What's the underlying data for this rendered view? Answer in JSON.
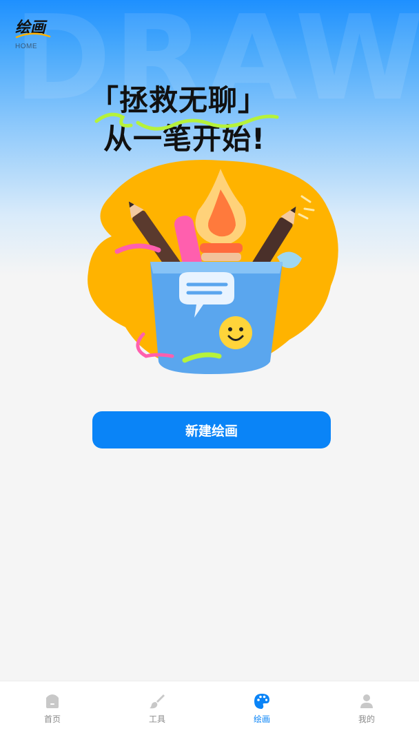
{
  "header": {
    "brand_title": "绘画",
    "brand_subtitle": "HOME",
    "watermark": "DRAWI"
  },
  "hero": {
    "slogan_line1": "「拯救无聊」",
    "slogan_line2": "从一笔开始!"
  },
  "main": {
    "new_drawing_label": "新建绘画"
  },
  "tabbar": {
    "items": [
      {
        "label": "首页",
        "icon": "home-icon"
      },
      {
        "label": "工具",
        "icon": "brush-icon"
      },
      {
        "label": "绘画",
        "icon": "palette-icon"
      },
      {
        "label": "我的",
        "icon": "user-icon"
      }
    ],
    "active_index": 2
  },
  "colors": {
    "primary": "#0a84f7",
    "accent_yellow": "#ffb300",
    "accent_green": "#b6f23a",
    "tab_inactive": "#c8c8c8"
  }
}
